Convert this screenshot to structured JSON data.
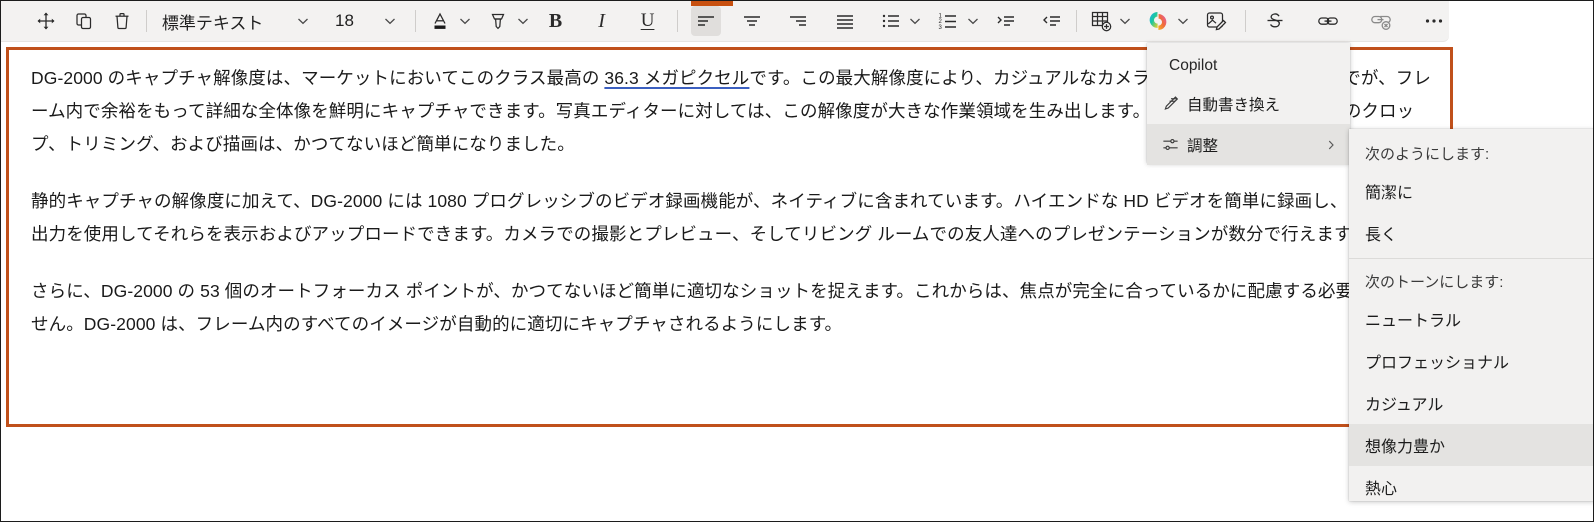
{
  "toolbar": {
    "buttons": [
      {
        "name": "move-icon",
        "label": "移動"
      },
      {
        "name": "copy-icon",
        "label": "コピー"
      },
      {
        "name": "delete-icon",
        "label": "削除"
      }
    ],
    "style_name": "標準テキスト",
    "font_size": "18",
    "font_color_label": "フォントの色",
    "highlight_label": "蛍光ペン",
    "bold_label": "B",
    "italic_label": "I",
    "underline_label": "U",
    "align_left_label": "左揃え",
    "align_center_label": "中央揃え",
    "align_right_label": "右揃え",
    "align_justify_label": "両端揃え",
    "bullet_list_label": "箇条書き",
    "numbered_list_label": "段落番号",
    "indent_increase_label": "インデントを増やす",
    "indent_decrease_label": "インデントを減らす",
    "table_label": "テーブルの挿入",
    "copilot_label": "Copilot",
    "image_label": "画像の編集",
    "strikethrough_label": "取り消し線",
    "link_label": "リンク",
    "unlink_label": "リンクの解除",
    "more_label": "その他のオプション",
    "accent_color": "#c8500f"
  },
  "document": {
    "paragraphs": [
      {
        "id": "p1",
        "segments": [
          {
            "text": "DG-2000 のキャプチャ解像度は、マーケットにおいてこのクラス最高の "
          },
          {
            "text": "36.3 メガピクセル",
            "style": "link-underline"
          },
          {
            "text": "です。この最大解像度により、カジュアルなカメラマンから熱心な写真家までが、フレーム内で余裕をもって詳細な全体像を鮮明にキャプチャできます。写真エディターに対しては、この解像度が大きな作業領域を生み出します。写真編集ソフトウェアでのクロップ、トリミング、および描画は、かつてないほど簡単になりました。"
          }
        ]
      },
      {
        "id": "p2",
        "segments": [
          {
            "text": "静的キャプチャの解像度に加えて、DG-2000 には 1080 プログレッシブのビデオ録画機能が、ネイティブに含まれています。ハイエンドな HD ビデオを簡単に録画し、内蔵 HDMI 出力を使用してそれらを表示およびアップロードできます。カメラでの撮影とプレビュー、そしてリビング ルームでの友人達へのプレゼンテーションが数分で行えます。"
          }
        ]
      },
      {
        "id": "p3",
        "segments": [
          {
            "text": "さらに、DG-2000 の 53 個のオートフォーカス ポイントが、かつてないほど簡単に適切なショットを捉えます。これからは、焦点が完全に合っているかに配慮する必要はありません。DG-2000 は、フレーム内のすべてのイメージが自動的に適切にキャプチャされるようにします。"
          }
        ]
      }
    ],
    "border_color": "#c0501b"
  },
  "copilot_menu": {
    "header": "Copilot",
    "items": [
      {
        "label": "自動書き換え",
        "icon": "rewrite-pen-icon",
        "has_submenu": false,
        "highlighted": false
      },
      {
        "label": "調整",
        "icon": "tune-sliders-icon",
        "has_submenu": true,
        "highlighted": true
      }
    ]
  },
  "tone_menu": {
    "length_header": "次のようにします:",
    "length_options": [
      {
        "label": "簡潔に",
        "highlighted": false
      },
      {
        "label": "長く",
        "highlighted": false
      }
    ],
    "tone_header": "次のトーンにします:",
    "tone_options": [
      {
        "label": "ニュートラル",
        "highlighted": false
      },
      {
        "label": "プロフェッショナル",
        "highlighted": false
      },
      {
        "label": "カジュアル",
        "highlighted": false
      },
      {
        "label": "想像力豊か",
        "highlighted": true
      },
      {
        "label": "熱心",
        "highlighted": false
      }
    ]
  }
}
